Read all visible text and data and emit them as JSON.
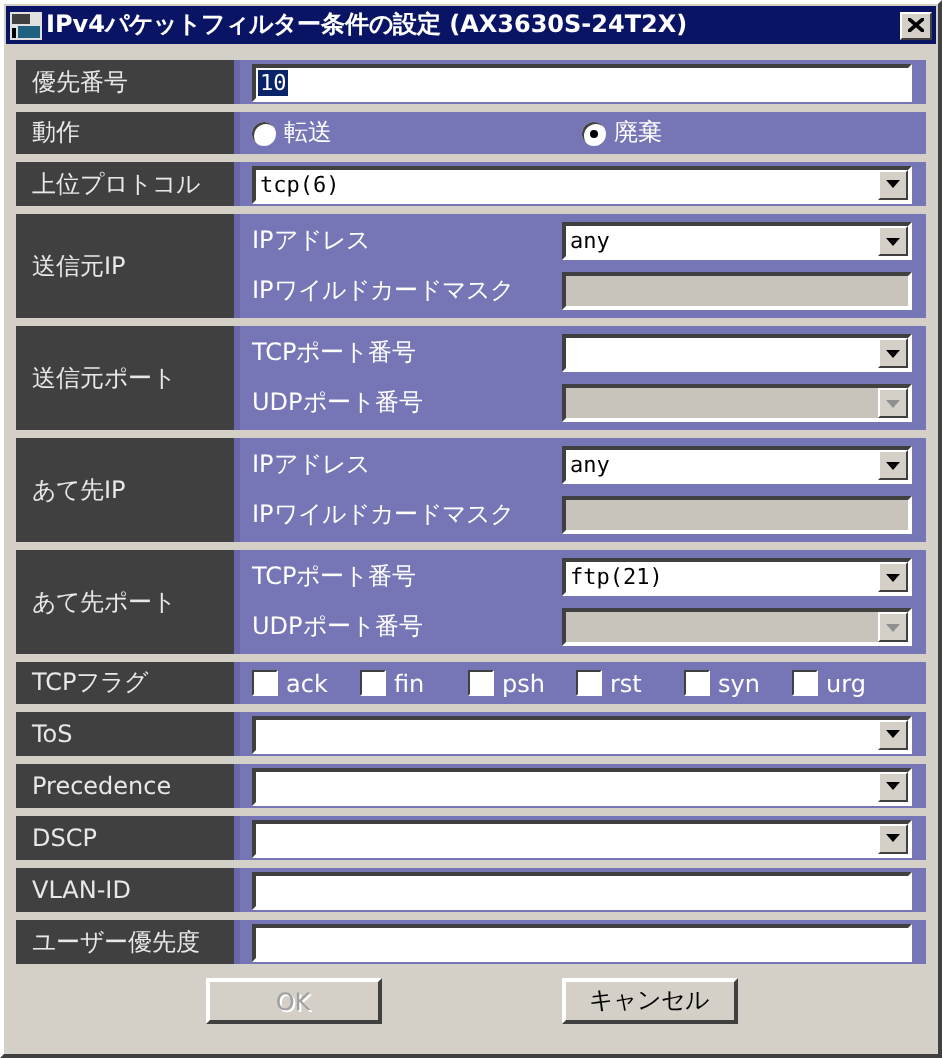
{
  "window": {
    "title": "IPv4パケットフィルター条件の設定 (AX3630S-24T2X)"
  },
  "rows": [
    {
      "kind": "text",
      "label": "優先番号",
      "value": "10",
      "value_selected": true,
      "disabled": false
    },
    {
      "kind": "radio",
      "label": "動作",
      "options": [
        {
          "label": "転送",
          "selected": false
        },
        {
          "label": "廃棄",
          "selected": true
        }
      ]
    },
    {
      "kind": "select",
      "label": "上位プロトコル",
      "value": "tcp(6)",
      "disabled": false
    },
    {
      "kind": "group",
      "label": "送信元IP",
      "fields": [
        {
          "kind": "select",
          "label": "IPアドレス",
          "value": "any",
          "disabled": false
        },
        {
          "kind": "text",
          "label": "IPワイルドカードマスク",
          "disabled": true
        }
      ]
    },
    {
      "kind": "group",
      "label": "送信元ポート",
      "fields": [
        {
          "kind": "select",
          "label": "TCPポート番号",
          "disabled": false
        },
        {
          "kind": "select",
          "label": "UDPポート番号",
          "disabled": true
        }
      ]
    },
    {
      "kind": "group",
      "label": "あて先IP",
      "fields": [
        {
          "kind": "select",
          "label": "IPアドレス",
          "value": "any",
          "disabled": false
        },
        {
          "kind": "text",
          "label": "IPワイルドカードマスク",
          "disabled": true
        }
      ]
    },
    {
      "kind": "group",
      "label": "あて先ポート",
      "fields": [
        {
          "kind": "select",
          "label": "TCPポート番号",
          "value": "ftp(21)",
          "disabled": false
        },
        {
          "kind": "select",
          "label": "UDPポート番号",
          "disabled": true
        }
      ]
    },
    {
      "kind": "checks",
      "label": "TCPフラグ",
      "options": [
        {
          "label": "ack",
          "checked": false
        },
        {
          "label": "fin",
          "checked": false
        },
        {
          "label": "psh",
          "checked": false
        },
        {
          "label": "rst",
          "checked": false
        },
        {
          "label": "syn",
          "checked": false
        },
        {
          "label": "urg",
          "checked": false
        }
      ]
    },
    {
      "kind": "select",
      "label": "ToS",
      "disabled": false
    },
    {
      "kind": "select",
      "label": "Precedence",
      "disabled": false
    },
    {
      "kind": "select",
      "label": "DSCP",
      "disabled": false
    },
    {
      "kind": "text",
      "label": "VLAN-ID",
      "disabled": false
    },
    {
      "kind": "text",
      "label": "ユーザー優先度",
      "disabled": false
    }
  ],
  "buttons": [
    {
      "label": "OK",
      "disabled": true
    },
    {
      "label": "キャンセル",
      "disabled": false
    }
  ]
}
